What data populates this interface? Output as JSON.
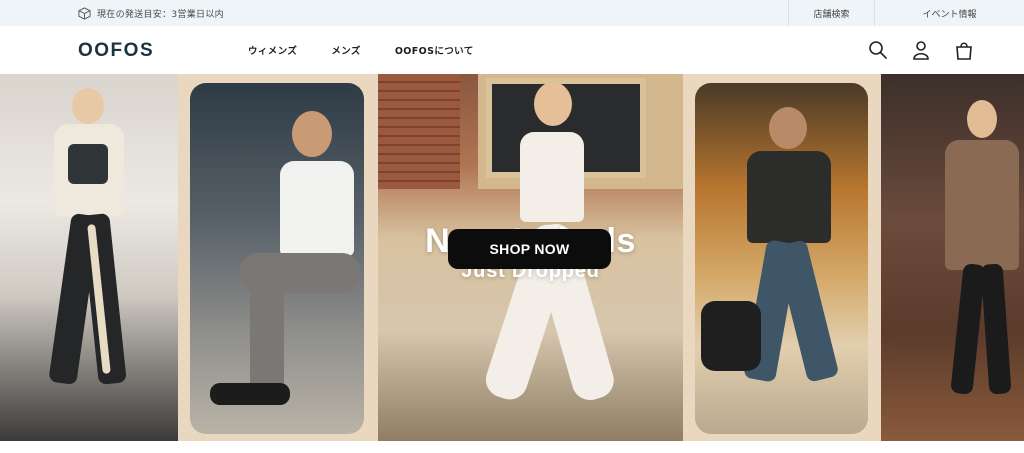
{
  "announcement": {
    "shipping_text": "現在の発送目安：3営業日以内",
    "icon": "package-icon",
    "links": {
      "store_search": "店舗検索",
      "events": "イベント情報"
    }
  },
  "header": {
    "logo": "OOFOS",
    "nav": [
      "ウィメンズ",
      "メンズ",
      "OOFOSについて"
    ],
    "icons": [
      "search-icon",
      "account-icon",
      "cart-icon"
    ]
  },
  "hero": {
    "headline": "New Arrivals",
    "subheadline": "Just Dropped",
    "cta_label": "SHOP NOW",
    "colors": {
      "background": "#e9d7bf",
      "cta": "#0c0c0c",
      "text": "#ffffff"
    }
  }
}
